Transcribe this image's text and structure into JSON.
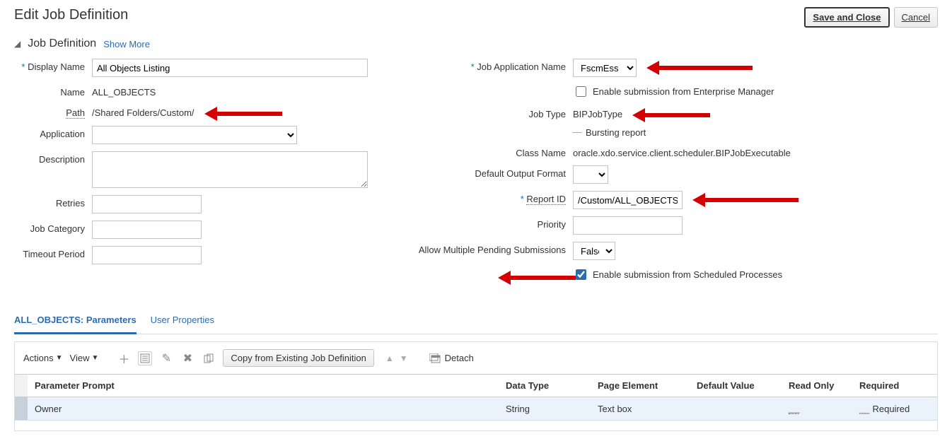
{
  "page": {
    "title": "Edit Job Definition",
    "save_close": "Save and Close",
    "cancel": "Cancel"
  },
  "section": {
    "title": "Job Definition",
    "show_more": "Show More"
  },
  "left": {
    "display_name_label": "Display Name",
    "display_name_value": "All Objects Listing",
    "name_label": "Name",
    "name_value": "ALL_OBJECTS",
    "path_label": "Path",
    "path_value": "/Shared Folders/Custom/",
    "application_label": "Application",
    "description_label": "Description",
    "retries_label": "Retries",
    "job_category_label": "Job Category",
    "timeout_label": "Timeout Period"
  },
  "right": {
    "job_app_name_label": "Job Application Name",
    "job_app_name_value": "FscmEss",
    "enable_em_label": "Enable submission from Enterprise Manager",
    "enable_em_checked": false,
    "job_type_label": "Job Type",
    "job_type_value": "BIPJobType",
    "bursting_label": "Bursting report",
    "class_name_label": "Class Name",
    "class_name_value": "oracle.xdo.service.client.scheduler.BIPJobExecutable",
    "default_output_label": "Default Output Format",
    "report_id_label": "Report ID",
    "report_id_value": "/Custom/ALL_OBJECTS_R",
    "priority_label": "Priority",
    "allow_multiple_label": "Allow Multiple Pending Submissions",
    "allow_multiple_value": "False",
    "enable_sched_label": "Enable submission from Scheduled Processes",
    "enable_sched_checked": true
  },
  "tabs": {
    "params": "ALL_OBJECTS: Parameters",
    "user_props": "User Properties"
  },
  "toolbar": {
    "actions": "Actions",
    "view": "View",
    "copy_btn": "Copy from Existing Job Definition",
    "detach": "Detach"
  },
  "table": {
    "headers": {
      "prompt": "Parameter Prompt",
      "data_type": "Data Type",
      "page_element": "Page Element",
      "default_value": "Default Value",
      "read_only": "Read Only",
      "required": "Required"
    },
    "rows": [
      {
        "prompt": "Owner",
        "data_type": "String",
        "page_element": "Text box",
        "default_value": "",
        "read_only": "__",
        "required": "Required"
      }
    ]
  }
}
